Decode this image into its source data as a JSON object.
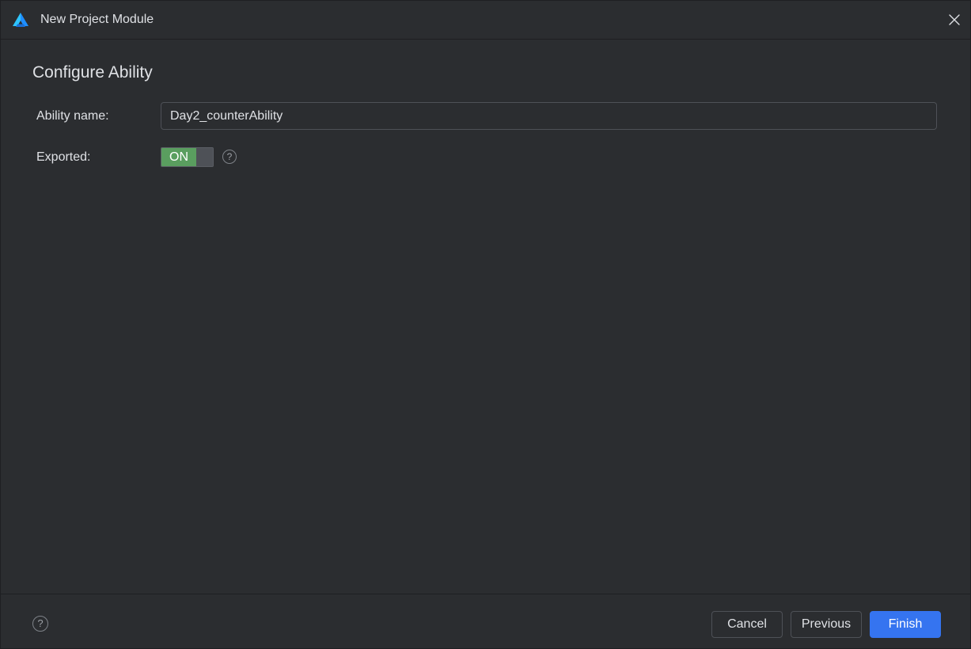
{
  "window": {
    "title": "New Project Module"
  },
  "page": {
    "section_title": "Configure Ability"
  },
  "form": {
    "ability_name_label": "Ability name:",
    "ability_name_value": "Day2_counterAbility",
    "exported_label": "Exported:",
    "exported_toggle_text": "ON",
    "exported_state": true,
    "help_glyph": "?"
  },
  "footer": {
    "help_glyph": "?",
    "cancel_label": "Cancel",
    "previous_label": "Previous",
    "finish_label": "Finish"
  },
  "icons": {
    "logo": "deveco-logo-icon",
    "close": "close-icon",
    "help": "help-icon"
  },
  "colors": {
    "background": "#2b2d30",
    "accent": "#3574f0",
    "toggle_on": "#5a9e5f",
    "text": "#dfe1e5"
  }
}
